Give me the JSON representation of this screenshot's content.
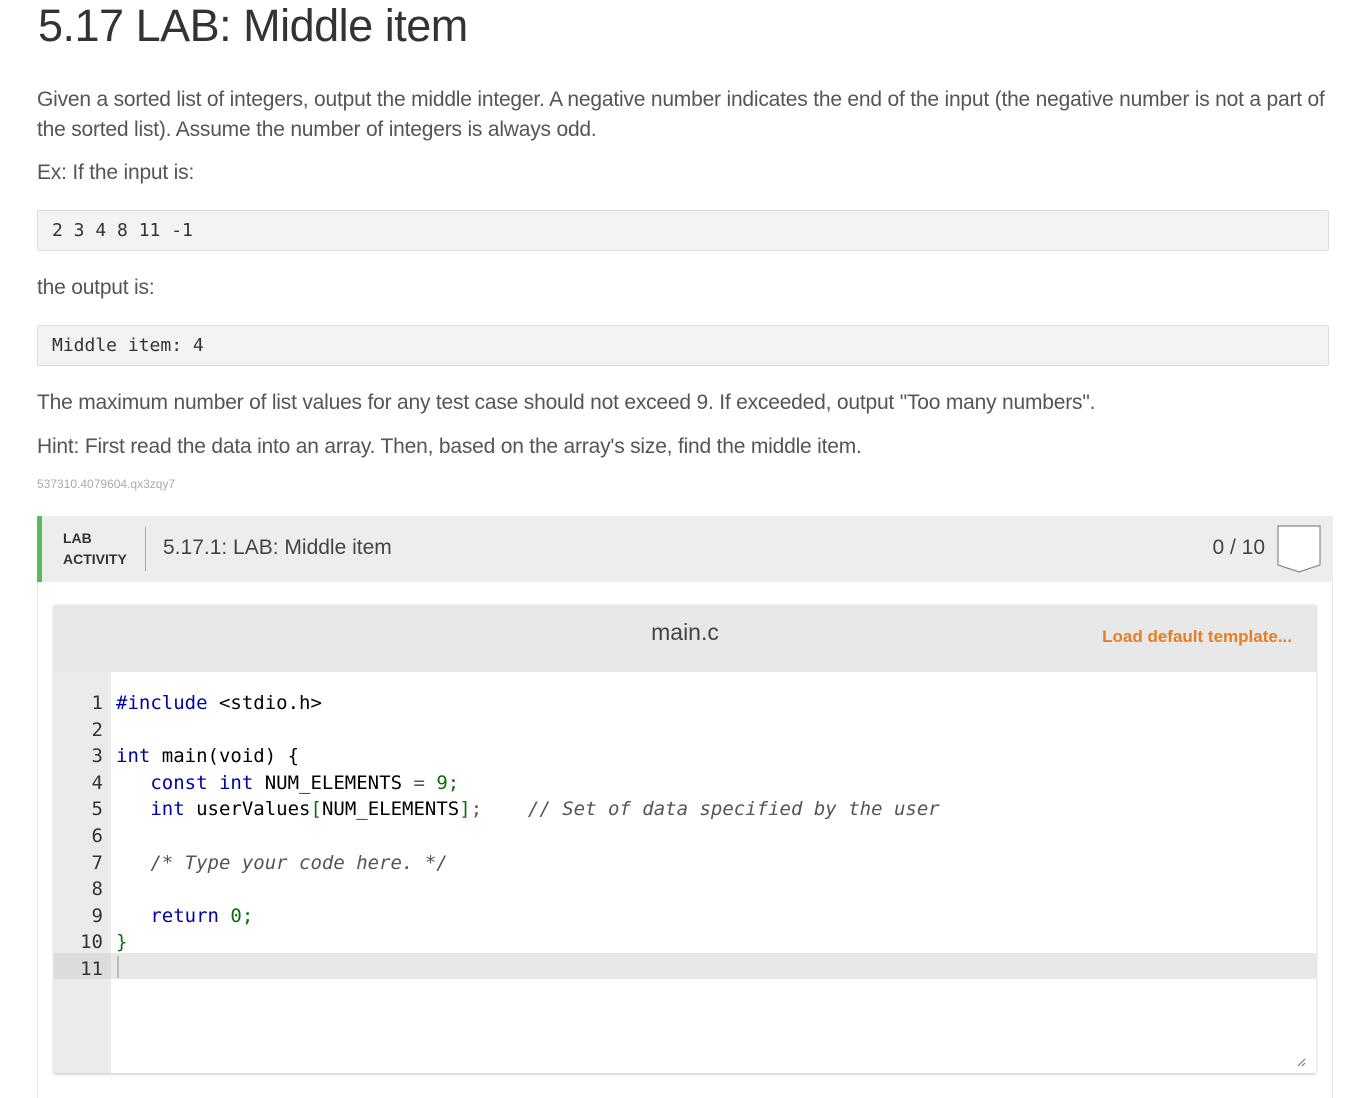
{
  "page": {
    "title": "5.17 LAB: Middle item",
    "intro": "Given a sorted list of integers, output the middle integer. A negative number indicates the end of the input (the negative number is not a part of the sorted list). Assume the number of integers is always odd.",
    "example_label": "Ex: If the input is:",
    "example_input": "2 3 4 8 11 -1",
    "output_label": "the output is:",
    "example_output": "Middle item: 4",
    "max_note": "The maximum number of list values for any test case should not exceed 9. If exceeded, output \"Too many numbers\".",
    "hint": "Hint: First read the data into an array. Then, based on the array's size, find the middle item.",
    "content_id": "537310.4079604.qx3zqy7"
  },
  "lab": {
    "label_line1": "LAB",
    "label_line2": "ACTIVITY",
    "title": "5.17.1: LAB: Middle item",
    "score": "0 / 10",
    "accent_color": "#5cb85c"
  },
  "editor": {
    "filename": "main.c",
    "load_default": "Load default template...",
    "line_numbers": [
      "1",
      "2",
      "3",
      "4",
      "5",
      "6",
      "7",
      "8",
      "9",
      "10",
      "11"
    ],
    "lines": {
      "l1_kw": "#include",
      "l1_rest": " <stdio.h>",
      "l3_kw": "int",
      "l3_rest": " main(void) {",
      "l4_indent": "   ",
      "l4_kw1": "const",
      "l4_kw2": " int",
      "l4_mid": " NUM_ELEMENTS ",
      "l4_eq": "=",
      "l4_val": " 9;",
      "l5_indent": "   ",
      "l5_kw": "int",
      "l5_a": " userValues",
      "l5_b": "[",
      "l5_c": "NUM_ELEMENTS",
      "l5_d": "]",
      "l5_e": ";",
      "l5_comment": "    // Set of data specified by the user",
      "l7_comment": "   /* Type your code here. */",
      "l9_indent": "   ",
      "l9_kw": "return",
      "l9_val": " 0;",
      "l10": "}"
    }
  }
}
